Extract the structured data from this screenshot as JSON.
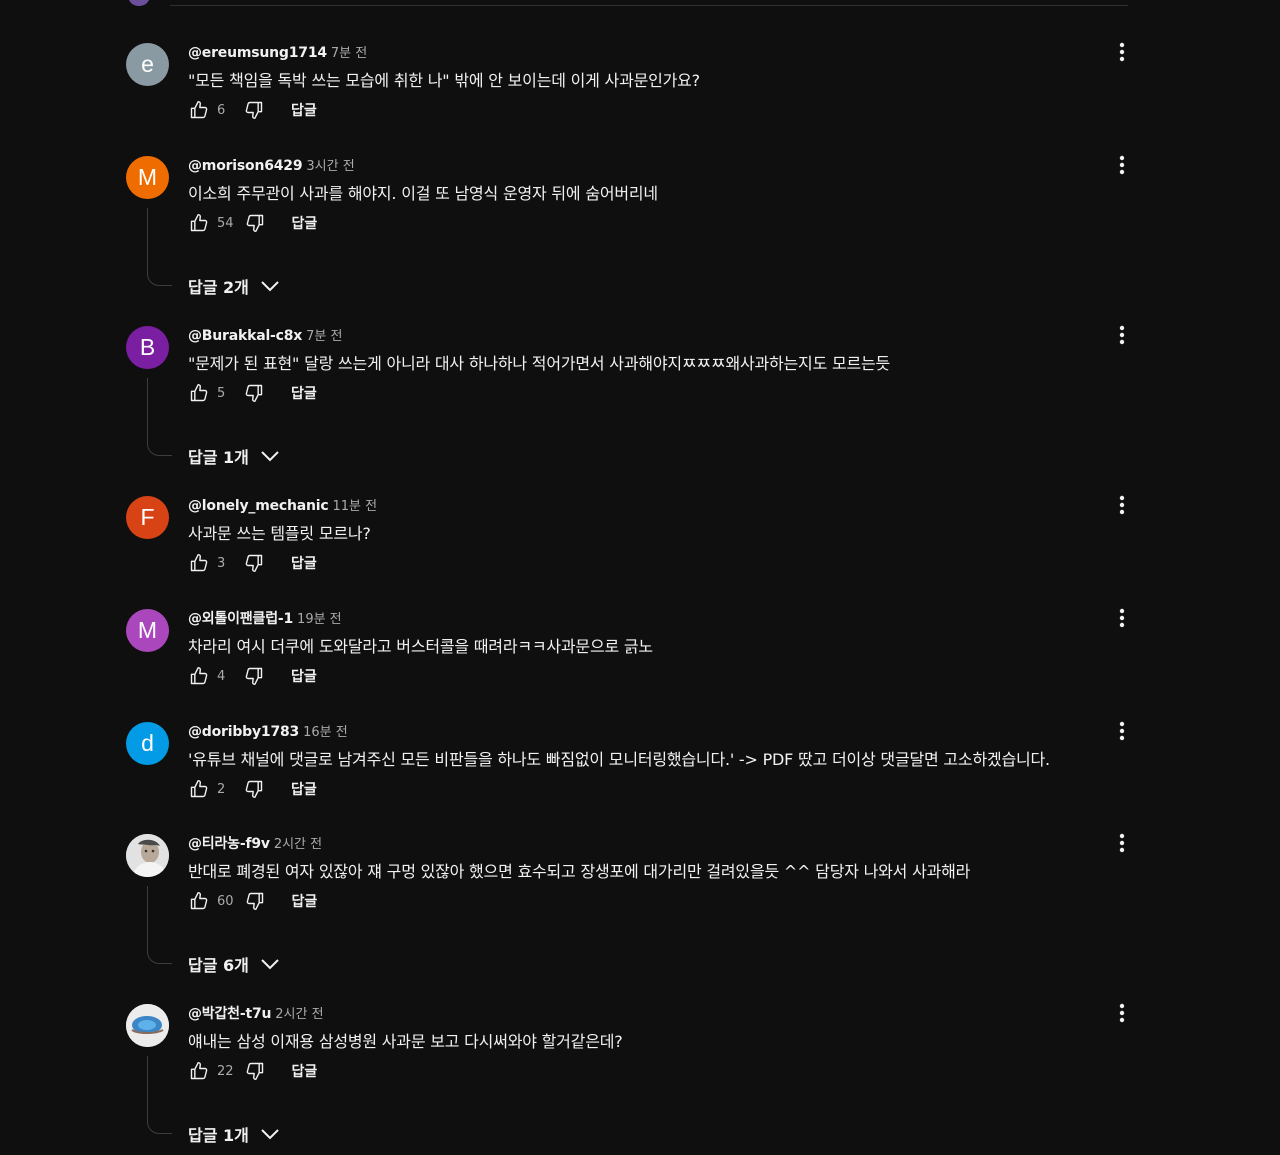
{
  "ui": {
    "reply_label": "답글",
    "colors": {
      "background": "#0f0f0f",
      "text": "#f1f1f1",
      "secondary_text": "#aaaaaa"
    },
    "icons": {
      "like": "thumb-up-icon",
      "dislike": "thumb-down-icon",
      "more": "more-vert-icon",
      "expand": "chevron-down-icon"
    }
  },
  "comments": [
    {
      "avatar_letter": "e",
      "avatar_color": "#8a9aa2",
      "author": "@ereumsung1714",
      "time": "7분 전",
      "text": "\"모든 책임을 독박 쓰는 모습에 취한 나\" 밖에 안 보이는데 이게 사과문인가요?",
      "likes": "6",
      "replies": null
    },
    {
      "avatar_letter": "M",
      "avatar_color": "#ef6c00",
      "author": "@morison6429",
      "time": "3시간 전",
      "text": "이소희 주무관이 사과를 해야지. 이걸 또 남영식 운영자 뒤에 숨어버리네",
      "likes": "54",
      "replies": "답글 2개"
    },
    {
      "avatar_letter": "B",
      "avatar_color": "#7b1fa2",
      "author": "@Burakkal-c8x",
      "time": "7분 전",
      "text": "\"문제가 된 표현\" 달랑 쓰는게 아니라 대사 하나하나 적어가면서 사과해야지ㅉㅉㅉ왜사과하는지도 모르는듯",
      "likes": "5",
      "replies": "답글 1개"
    },
    {
      "avatar_letter": "F",
      "avatar_color": "#d84315",
      "author": "@lonely_mechanic",
      "time": "11분 전",
      "text": "사과문 쓰는 템플릿 모르나?",
      "likes": "3",
      "replies": null
    },
    {
      "avatar_letter": "M",
      "avatar_color": "#ab47bc",
      "author": "@외톨이팬클럽-1",
      "time": "19분 전",
      "text": "차라리 여시 더쿠에 도와달라고 버스터콜을 때려라ㅋㅋ사과문으로 긁노",
      "likes": "4",
      "replies": null
    },
    {
      "avatar_letter": "d",
      "avatar_color": "#039be5",
      "author": "@doribby1783",
      "time": "16분 전",
      "text": "'유튜브 채널에 댓글로 남겨주신 모든 비판들을 하나도 빠짐없이 모니터링했습니다.' -> PDF 땄고 더이상 댓글달면 고소하겠습니다.",
      "likes": "2",
      "replies": null
    },
    {
      "avatar_letter": "",
      "avatar_color": "#d9d9d9",
      "author": "@티라농-f9v",
      "time": "2시간 전",
      "text": "반대로 폐경된 여자 있잖아 쟤 구멍 있잖아 했으면 효수되고 장생포에 대가리만 걸려있을듯 ^^ 담당자 나와서 사과해라",
      "likes": "60",
      "replies": "답글 6개"
    },
    {
      "avatar_letter": "",
      "avatar_color": "#e6e6e6",
      "author": "@박갑천-t7u",
      "time": "2시간 전",
      "text": "얘내는 삼성 이재용 삼성병원 사과문 보고 다시써와야 할거같은데?",
      "likes": "22",
      "replies": "답글 1개"
    }
  ]
}
